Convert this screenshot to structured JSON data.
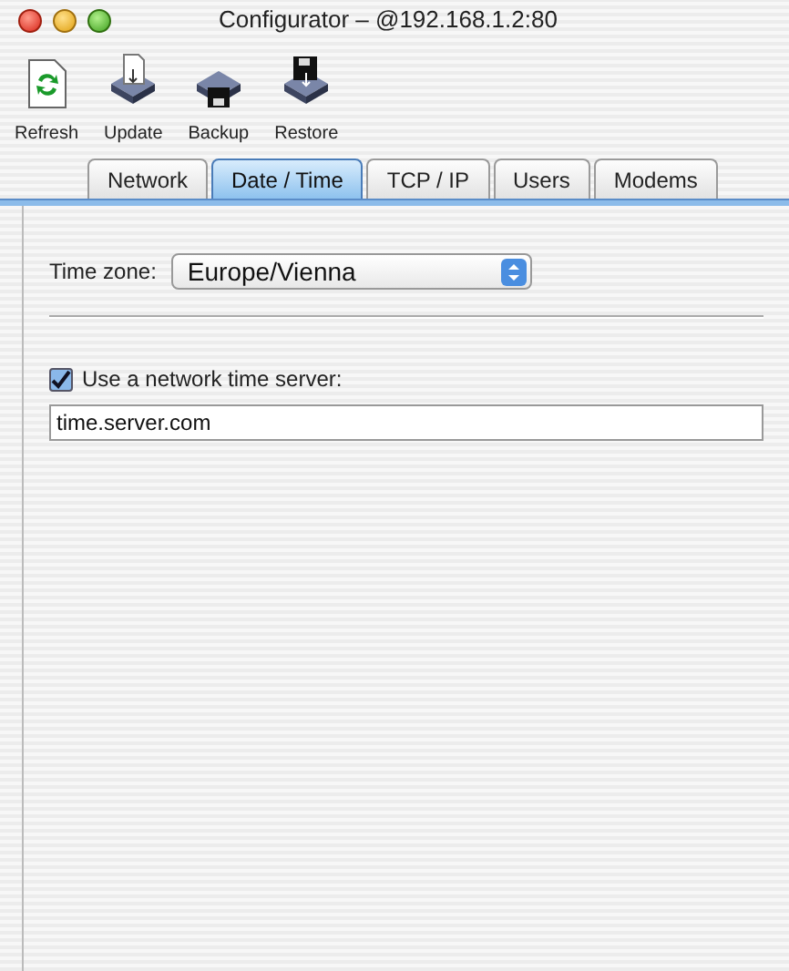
{
  "window": {
    "title": "Configurator – @192.168.1.2:80"
  },
  "toolbar": [
    {
      "kind": "refresh",
      "label": "Refresh"
    },
    {
      "kind": "update",
      "label": "Update"
    },
    {
      "kind": "backup",
      "label": "Backup"
    },
    {
      "kind": "restore",
      "label": "Restore"
    }
  ],
  "tabs": [
    {
      "label": "Network",
      "selected": false
    },
    {
      "label": "Date / Time",
      "selected": true
    },
    {
      "label": "TCP / IP",
      "selected": false
    },
    {
      "label": "Users",
      "selected": false
    },
    {
      "label": "Modems",
      "selected": false
    }
  ],
  "time_zone": {
    "label": "Time zone:",
    "value": "Europe/Vienna"
  },
  "time_server": {
    "label": "Use a network time server:",
    "checked": true,
    "value": "time.server.com"
  }
}
